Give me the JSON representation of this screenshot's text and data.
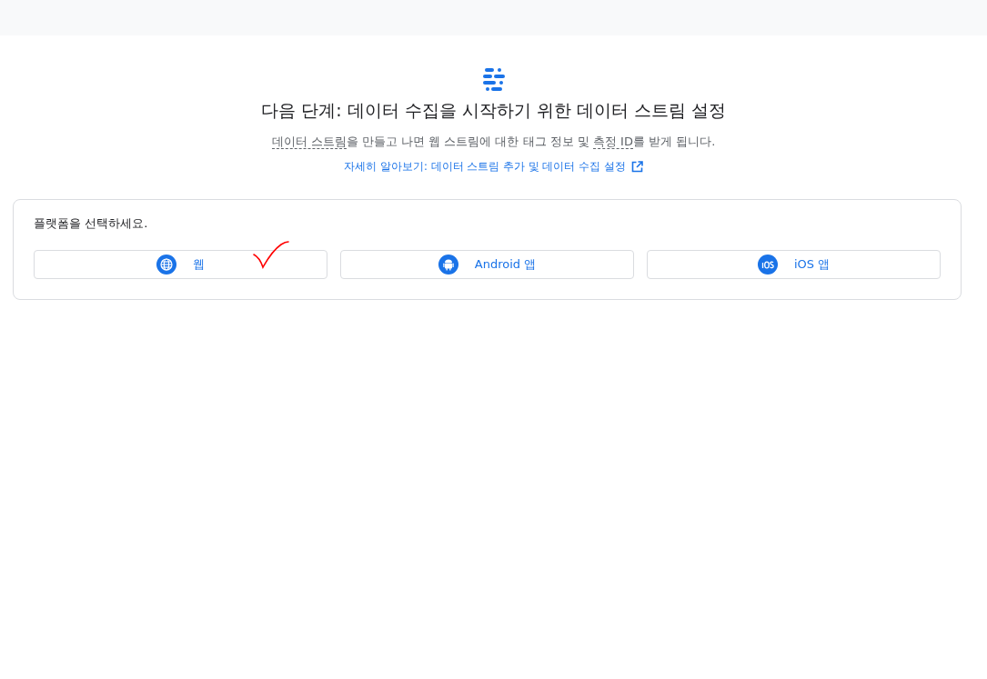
{
  "title": "다음 단계: 데이터 수집을 시작하기 위한 데이터 스트림 설정",
  "description": [
    {
      "kind": "term",
      "text": "데이터 스트림"
    },
    {
      "kind": "plain",
      "text": "을 만들고 나면 웹 스트림에 대한 태그 정보 및 "
    },
    {
      "kind": "term",
      "text": "측정 ID"
    },
    {
      "kind": "plain",
      "text": "를 받게 됩니다."
    }
  ],
  "learn_more_link": "자세히 알아보기: 데이터 스트림 추가 및 데이터 수집 설정",
  "platform_card": {
    "label": "플랫폼을 선택하세요.",
    "platforms": [
      {
        "kind": "web",
        "label": "웹"
      },
      {
        "kind": "android",
        "label": "Android 앱"
      },
      {
        "kind": "ios",
        "label": "iOS 앱"
      }
    ]
  },
  "annotations": [
    {
      "kind": "checkmark",
      "color": "#ff0000"
    }
  ]
}
